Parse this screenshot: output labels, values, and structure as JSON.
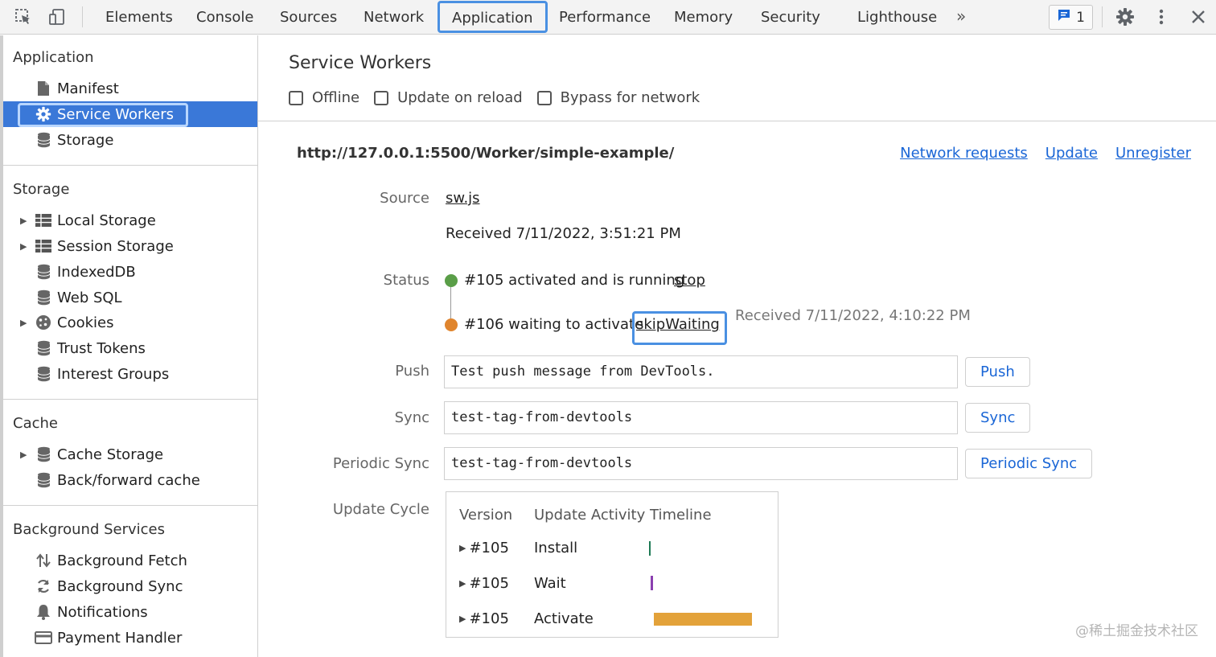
{
  "toolbar": {
    "tabs": [
      "Elements",
      "Console",
      "Sources",
      "Network",
      "Application",
      "Performance",
      "Memory",
      "Security",
      "Lighthouse"
    ],
    "active_tab": "Application",
    "more_tabs": "»",
    "issues_count": "1",
    "accent": "#4a90e2"
  },
  "sidebar": {
    "application": {
      "title": "Application",
      "items": [
        "Manifest",
        "Service Workers",
        "Storage"
      ],
      "selected": "Service Workers"
    },
    "storage": {
      "title": "Storage",
      "items": [
        "Local Storage",
        "Session Storage",
        "IndexedDB",
        "Web SQL",
        "Cookies",
        "Trust Tokens",
        "Interest Groups"
      ]
    },
    "cache": {
      "title": "Cache",
      "items": [
        "Cache Storage",
        "Back/forward cache"
      ]
    },
    "background": {
      "title": "Background Services",
      "items": [
        "Background Fetch",
        "Background Sync",
        "Notifications",
        "Payment Handler"
      ]
    },
    "selected_color": "#3a78d8"
  },
  "main": {
    "title": "Service Workers",
    "options": [
      "Offline",
      "Update on reload",
      "Bypass for network"
    ],
    "scope": "http://127.0.0.1:5500/Worker/simple-example/",
    "scope_links": [
      "Network requests",
      "Update",
      "Unregister"
    ],
    "source_label": "Source",
    "source_file": "sw.js",
    "source_received": "Received 7/11/2022, 3:51:21 PM",
    "status_label": "Status",
    "status_active": "#105 activated and is running",
    "status_active_link": "stop",
    "status_active_color": "#5a9e48",
    "status_waiting": "#106 waiting to activate",
    "status_waiting_link": "skipWaiting",
    "status_waiting_received": "Received 7/11/2022, 4:10:22 PM",
    "status_waiting_color": "#e0852e",
    "push_label": "Push",
    "push_value": "Test push message from DevTools.",
    "push_button": "Push",
    "sync_label": "Sync",
    "sync_value": "test-tag-from-devtools",
    "sync_button": "Sync",
    "periodic_label": "Periodic Sync",
    "periodic_value": "test-tag-from-devtools",
    "periodic_button": "Periodic Sync",
    "cycle_label": "Update Cycle",
    "cycle_headers": [
      "Version",
      "Update Activity",
      "Timeline"
    ],
    "cycle_rows": [
      {
        "version": "#105",
        "activity": "Install",
        "color": "#1e7a55"
      },
      {
        "version": "#105",
        "activity": "Wait",
        "color": "#8b3fb0"
      },
      {
        "version": "#105",
        "activity": "Activate",
        "color": "#e3a23a"
      }
    ]
  },
  "watermark": "@稀土掘金技术社区"
}
